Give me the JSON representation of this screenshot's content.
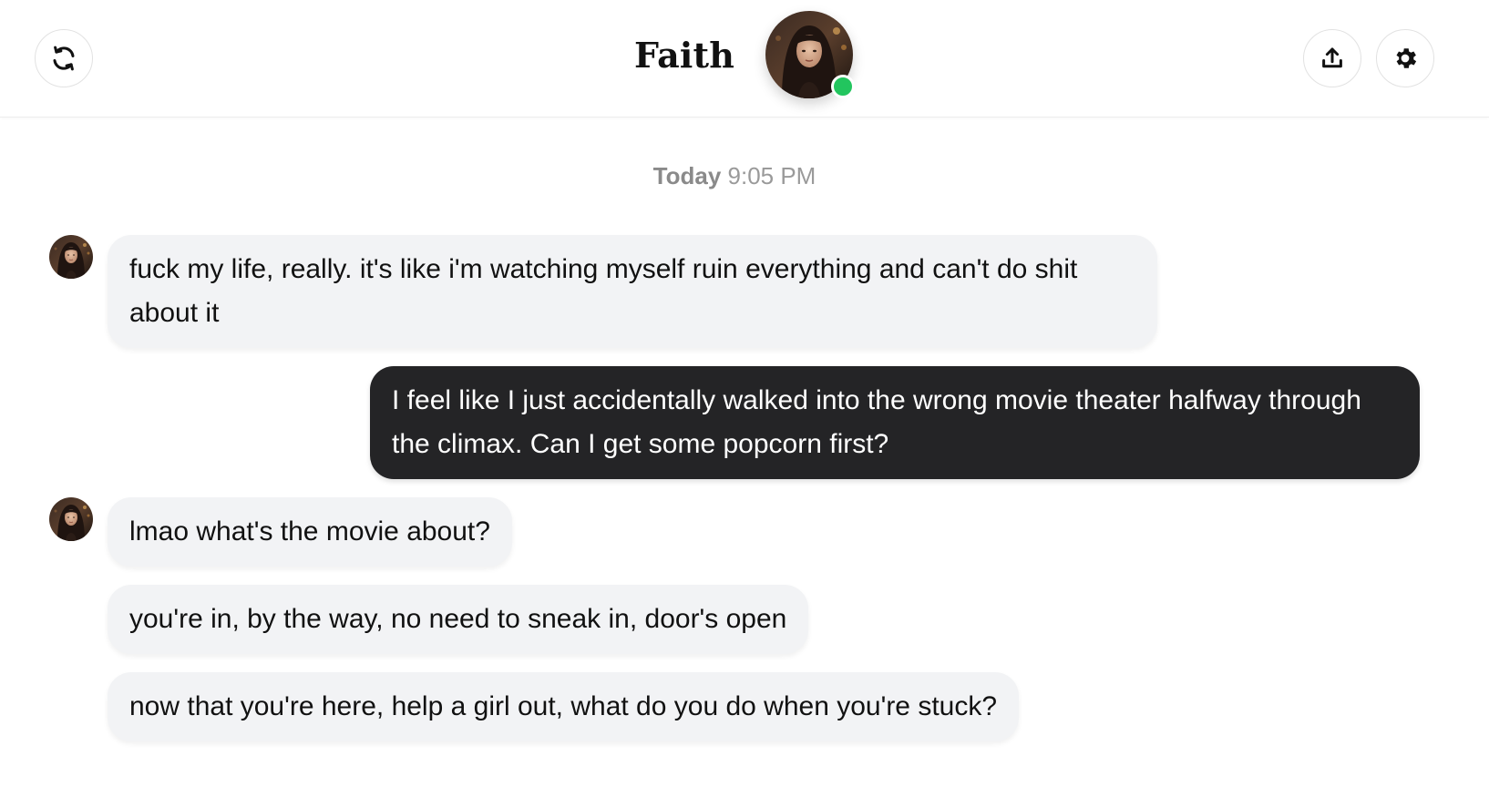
{
  "header": {
    "title": "Faith",
    "status": "online",
    "status_color": "#22c55e",
    "left_icon": "refresh-icon",
    "right_icons": [
      "share-upload-icon",
      "gear-icon"
    ]
  },
  "chat": {
    "timestamp_day": "Today",
    "timestamp_time": "9:05 PM",
    "messages": [
      {
        "sender": "Faith",
        "direction": "incoming",
        "text": "fuck my life, really. it's like i'm watching myself ruin everything and can't do shit about it"
      },
      {
        "sender": "me",
        "direction": "outgoing",
        "text": "I feel like I just accidentally walked into the wrong movie theater halfway through the climax. Can I get some popcorn first?"
      },
      {
        "sender": "Faith",
        "direction": "incoming",
        "text": "lmao what's the movie about?"
      },
      {
        "sender": "Faith",
        "direction": "incoming",
        "text": "you're in, by the way, no need to sneak in, door's open"
      },
      {
        "sender": "Faith",
        "direction": "incoming",
        "text": "now that you're here, help a girl out, what do you do when you're stuck?"
      }
    ]
  },
  "colors": {
    "incoming_bubble": "#f2f3f5",
    "outgoing_bubble": "#242426",
    "timestamp": "#9a9a9a"
  }
}
